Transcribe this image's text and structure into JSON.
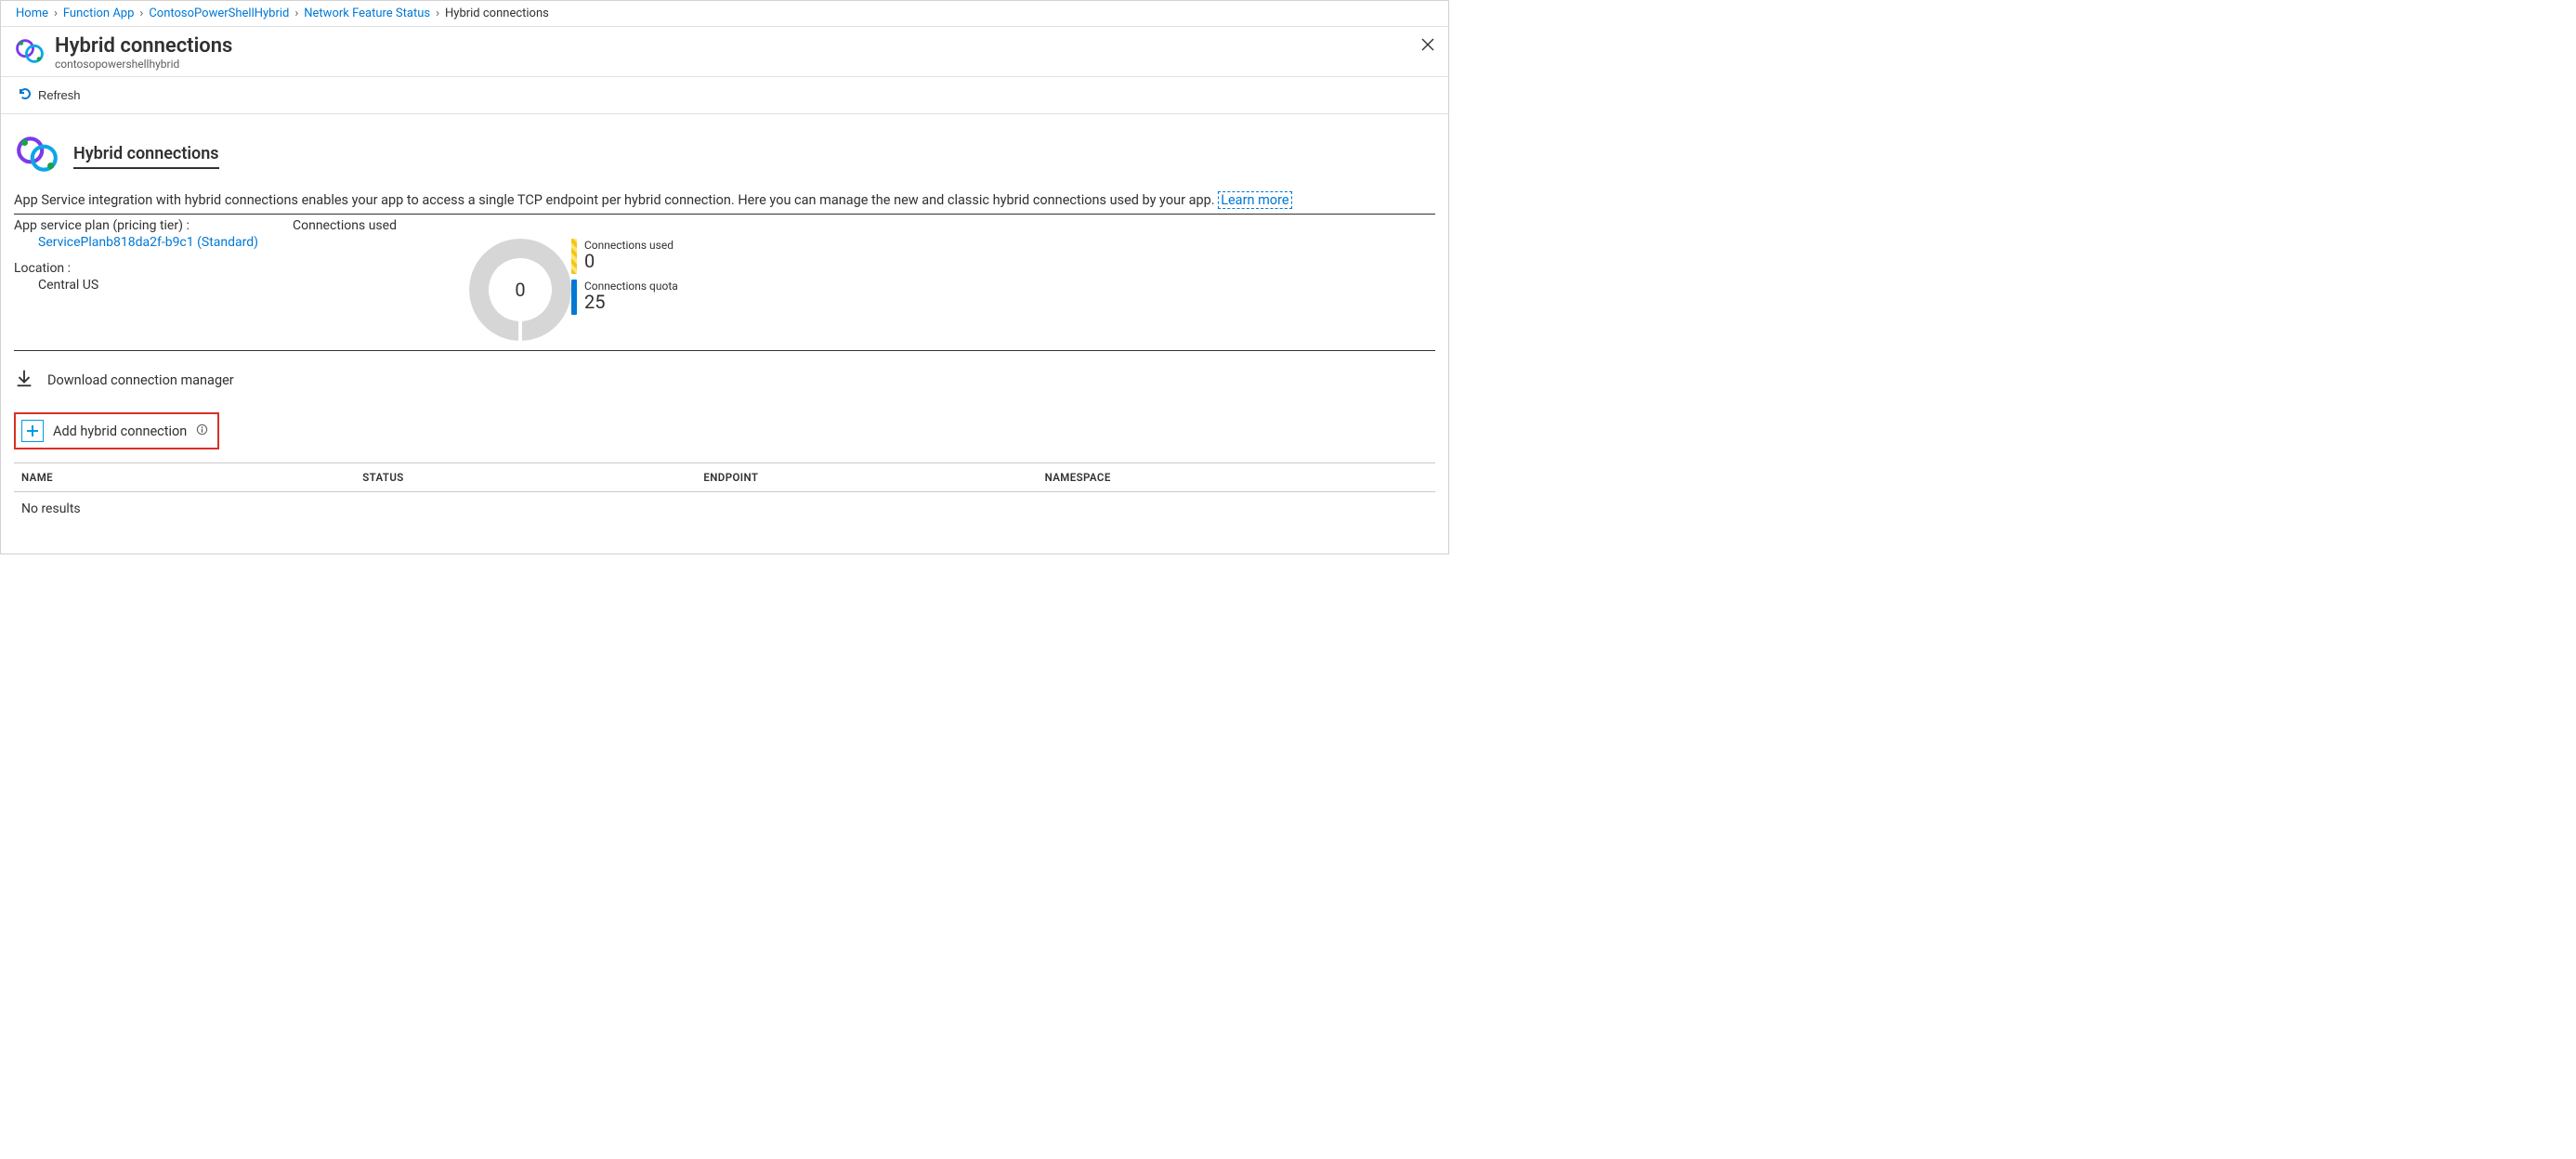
{
  "breadcrumb": {
    "items": [
      {
        "label": "Home"
      },
      {
        "label": "Function App"
      },
      {
        "label": "ContosoPowerShellHybrid"
      },
      {
        "label": "Network Feature Status"
      }
    ],
    "current": "Hybrid connections"
  },
  "header": {
    "title": "Hybrid connections",
    "subtitle": "contosopowershellhybrid"
  },
  "commandBar": {
    "refresh": "Refresh"
  },
  "section": {
    "title": "Hybrid connections",
    "description": "App Service integration with hybrid connections enables your app to access a single TCP endpoint per hybrid connection. Here you can manage the new and classic hybrid connections used by your app. ",
    "learnMore": "Learn more"
  },
  "plan": {
    "label": "App service plan (pricing tier) :",
    "value": "ServicePlanb818da2f-b9c1 (Standard)"
  },
  "location": {
    "label": "Location :",
    "value": "Central US"
  },
  "usage": {
    "header": "Connections used",
    "donutValue": "0",
    "used": {
      "label": "Connections used",
      "value": "0"
    },
    "quota": {
      "label": "Connections quota",
      "value": "25"
    }
  },
  "download": {
    "label": "Download connection manager"
  },
  "add": {
    "label": "Add hybrid connection"
  },
  "table": {
    "columns": [
      "NAME",
      "STATUS",
      "ENDPOINT",
      "NAMESPACE"
    ],
    "empty": "No results"
  },
  "chart_data": {
    "type": "pie",
    "title": "Connections used",
    "series": [
      {
        "name": "Connections used",
        "values": [
          0
        ]
      },
      {
        "name": "Connections quota",
        "values": [
          25
        ]
      }
    ],
    "categories": [
      "value"
    ]
  }
}
